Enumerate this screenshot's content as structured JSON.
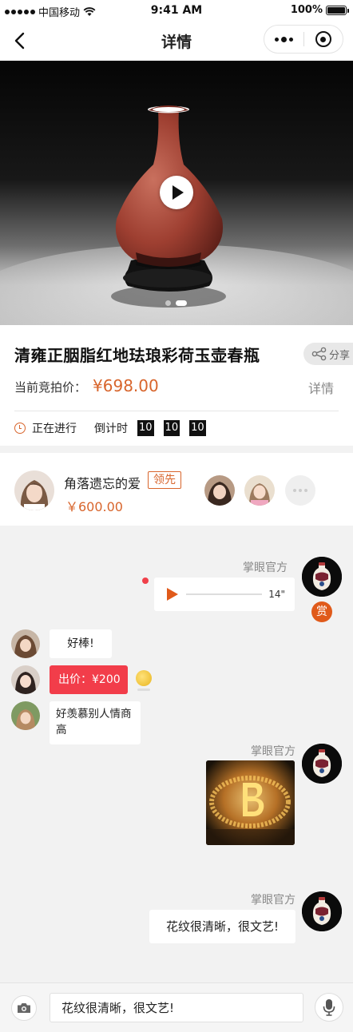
{
  "status_bar": {
    "carrier": "中国移动",
    "time": "9:41 AM",
    "battery": "100%"
  },
  "nav": {
    "title": "详情"
  },
  "product": {
    "name": "清雍正胭脂红地珐琅彩荷玉壶春瓶",
    "share_label": "分享",
    "price_label": "当前竞拍价：",
    "price": "¥698.00",
    "detail_label": "详情",
    "status": "正在进行",
    "countdown_label": "倒计时",
    "countdown": [
      "10",
      "10",
      "10"
    ]
  },
  "leader": {
    "name": "角落遗忘的爱",
    "badge": "领先",
    "amount": "￥600.00"
  },
  "chat": {
    "official_sender": "掌眼官方",
    "voice_duration": "14\"",
    "reward_label": "赏",
    "msg1": "好棒!",
    "bid_msg": "出价：¥200",
    "msg3": "好羡慕别人情商高",
    "msg_last": "花纹很清晰，很文艺!"
  },
  "input": {
    "value": "花纹很清晰，很文艺!"
  },
  "colors": {
    "accent": "#d8652c",
    "bid_red": "#f23d4a",
    "reward": "#e05a1a"
  }
}
